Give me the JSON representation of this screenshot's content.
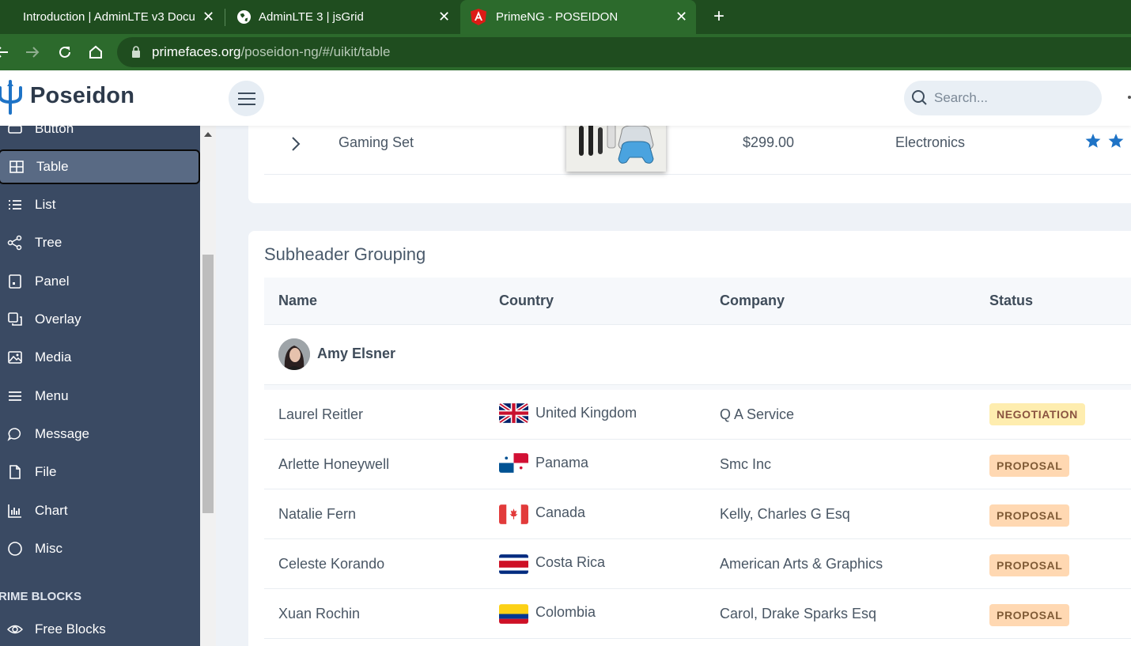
{
  "browser": {
    "tabs": [
      {
        "title": "Introduction | AdminLTE v3 Docu",
        "icon": "none",
        "active": false
      },
      {
        "title": "AdminLTE 3 | jsGrid",
        "icon": "globe-icon",
        "active": false
      },
      {
        "title": "PrimeNG - POSEIDON",
        "icon": "angular-icon",
        "active": true
      }
    ],
    "new_tab_label": "+",
    "url_host": "primefaces.org",
    "url_path": "/poseidon-ng/#/uikit/table"
  },
  "app": {
    "logo_text": "Poseidon",
    "search_placeholder": "Search..."
  },
  "sidebar": {
    "items": [
      {
        "label": "Button",
        "icon": "button-icon"
      },
      {
        "label": "Table",
        "icon": "table-icon",
        "active": true
      },
      {
        "label": "List",
        "icon": "list-icon"
      },
      {
        "label": "Tree",
        "icon": "share-icon"
      },
      {
        "label": "Panel",
        "icon": "panel-icon"
      },
      {
        "label": "Overlay",
        "icon": "clone-icon"
      },
      {
        "label": "Media",
        "icon": "image-icon"
      },
      {
        "label": "Menu",
        "icon": "bars-icon"
      },
      {
        "label": "Message",
        "icon": "comment-icon"
      },
      {
        "label": "File",
        "icon": "file-icon"
      },
      {
        "label": "Chart",
        "icon": "chart-bar-icon"
      },
      {
        "label": "Misc",
        "icon": "circle-icon"
      }
    ],
    "section_title": "RIME BLOCKS",
    "section_items": [
      {
        "label": "Free Blocks",
        "icon": "eye-icon"
      }
    ]
  },
  "product_row": {
    "name": "Gaming Set",
    "price": "$299.00",
    "category": "Electronics",
    "rating_visible_stars": 2
  },
  "subheader_table": {
    "title": "Subheader Grouping",
    "columns": [
      "Name",
      "Country",
      "Company",
      "Status"
    ],
    "group": {
      "name": "Amy Elsner"
    },
    "rows": [
      {
        "name": "Laurel Reitler",
        "country": "United Kingdom",
        "flag": "gb",
        "company": "Q A Service",
        "status": "NEGOTIATION",
        "status_type": "negotiation"
      },
      {
        "name": "Arlette Honeywell",
        "country": "Panama",
        "flag": "pa",
        "company": "Smc Inc",
        "status": "PROPOSAL",
        "status_type": "proposal"
      },
      {
        "name": "Natalie Fern",
        "country": "Canada",
        "flag": "ca",
        "company": "Kelly, Charles G Esq",
        "status": "PROPOSAL",
        "status_type": "proposal"
      },
      {
        "name": "Celeste Korando",
        "country": "Costa Rica",
        "flag": "cr",
        "company": "American Arts & Graphics",
        "status": "PROPOSAL",
        "status_type": "proposal"
      },
      {
        "name": "Xuan Rochin",
        "country": "Colombia",
        "flag": "co",
        "company": "Carol, Drake Sparks Esq",
        "status": "PROPOSAL",
        "status_type": "proposal"
      }
    ]
  },
  "colors": {
    "browser_frame": "#1f4d1f",
    "sidebar_bg": "#3a4a63",
    "sidebar_active": "#596a84",
    "star": "#1e73c6",
    "negotiation_bg": "#feedaf",
    "proposal_bg": "#ffd8b2"
  }
}
